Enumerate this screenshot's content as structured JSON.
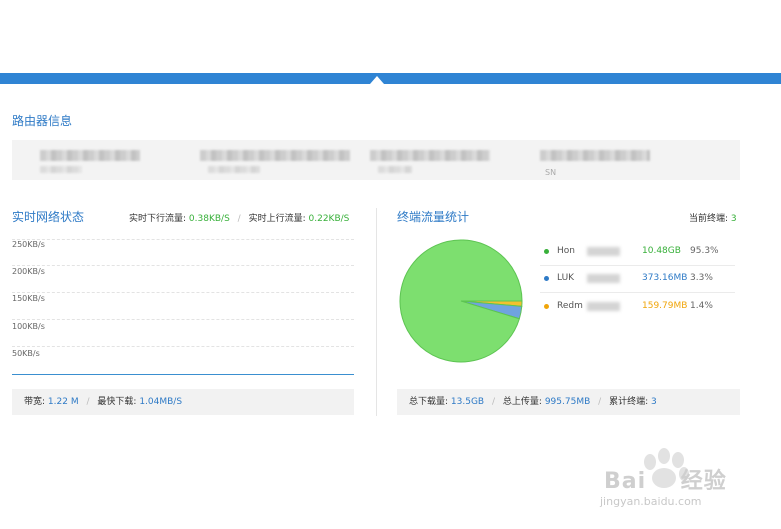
{
  "router_info": {
    "title": "路由器信息",
    "sn_label": "SN"
  },
  "network_status": {
    "title": "实时网络状态",
    "download_label": "实时下行流量:",
    "download_value": "0.38KB/S",
    "upload_label": "实时上行流量:",
    "upload_value": "0.22KB/S",
    "y_ticks": [
      "250KB/s",
      "200KB/s",
      "150KB/s",
      "100KB/s",
      "50KB/s"
    ],
    "bandwidth_label": "带宽:",
    "bandwidth_value": "1.22 M",
    "max_download_label": "最快下载:",
    "max_download_value": "1.04MB/S"
  },
  "terminal_stats": {
    "title": "终端流量统计",
    "current_label": "当前终端:",
    "current_value": "3",
    "total_download_label": "总下载量:",
    "total_download_value": "13.5GB",
    "total_upload_label": "总上传量:",
    "total_upload_value": "995.75MB",
    "cumulative_label": "累计终端:",
    "cumulative_value": "3"
  },
  "chart_data": {
    "type": "pie",
    "series": [
      {
        "name": "Hon",
        "value_label": "10.48GB",
        "percent": 95.3,
        "percent_label": "95.3%",
        "color": "#7ddf6f",
        "dot_color": "#38b03a",
        "amount_color": "#38b03a"
      },
      {
        "name": "LUK",
        "value_label": "373.16MB",
        "percent": 3.3,
        "percent_label": "3.3%",
        "color": "#6fa3e0",
        "dot_color": "#2e7ac6",
        "amount_color": "#2e7ac6"
      },
      {
        "name": "Redm",
        "value_label": "159.79MB",
        "percent": 1.4,
        "percent_label": "1.4%",
        "color": "#f2c12e",
        "dot_color": "#f0a50a",
        "amount_color": "#f0a50a"
      }
    ]
  },
  "watermark": {
    "brand": "Bai",
    "brand2": "经验",
    "url": "jingyan.baidu.com"
  }
}
